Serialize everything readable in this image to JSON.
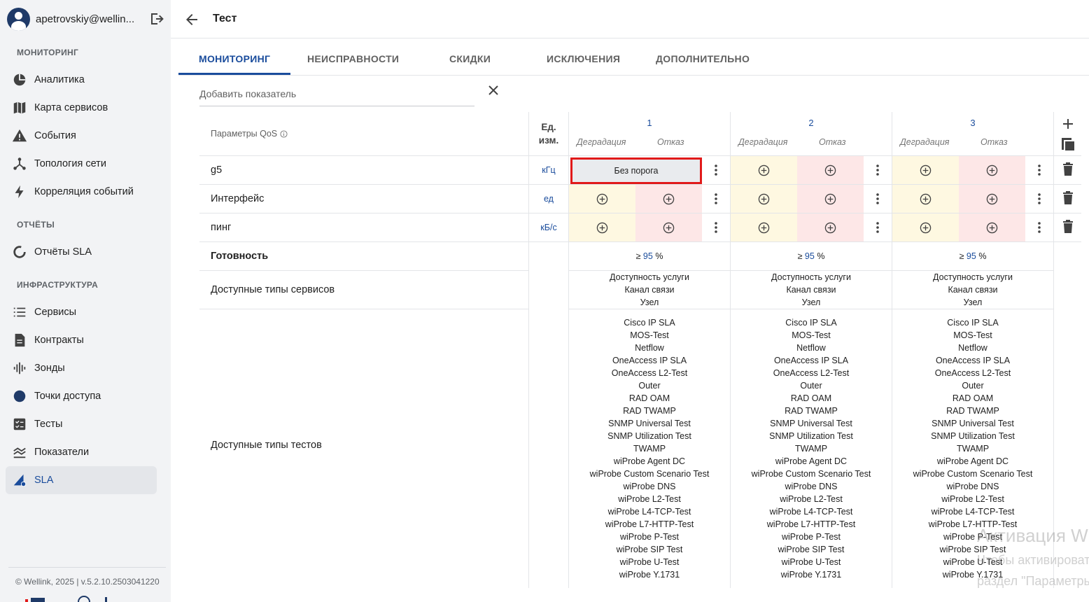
{
  "user": {
    "name": "apetrovskiy@wellin..."
  },
  "sidebar": {
    "sections": [
      {
        "title": "МОНИТОРИНГ",
        "items": [
          {
            "label": "Аналитика",
            "icon": "pie-chart-icon"
          },
          {
            "label": "Карта сервисов",
            "icon": "map-icon"
          },
          {
            "label": "События",
            "icon": "warning-icon"
          },
          {
            "label": "Топология сети",
            "icon": "topology-icon"
          },
          {
            "label": "Корреляция событий",
            "icon": "bolt-icon"
          }
        ]
      },
      {
        "title": "ОТЧЁТЫ",
        "items": [
          {
            "label": "Отчёты SLA",
            "icon": "progress-ring-icon"
          }
        ]
      },
      {
        "title": "ИНФРАСТРУКТУРА",
        "items": [
          {
            "label": "Сервисы",
            "icon": "list-icon"
          },
          {
            "label": "Контракты",
            "icon": "document-icon"
          },
          {
            "label": "Зонды",
            "icon": "waveform-icon"
          },
          {
            "label": "Точки доступа",
            "icon": "circle-icon"
          },
          {
            "label": "Тесты",
            "icon": "checklist-icon"
          },
          {
            "label": "Показатели",
            "icon": "chart-lines-icon"
          },
          {
            "label": "SLA",
            "icon": "sla-icon",
            "active": true
          }
        ]
      }
    ],
    "copyright": "© Wellink, 2025 | v.5.2.10.2503041220"
  },
  "header": {
    "title": "Тест"
  },
  "tabs": [
    "МОНИТОРИНГ",
    "НЕИСПРАВНОСТИ",
    "СКИДКИ",
    "ИСКЛЮЧЕНИЯ",
    "ДОПОЛНИТЕЛЬНО"
  ],
  "add_indicator": {
    "placeholder": "Добавить показатель"
  },
  "table": {
    "qos_header": "Параметры QoS",
    "unit_header_1": "Ед.",
    "unit_header_2": "изм.",
    "columns": [
      "1",
      "2",
      "3"
    ],
    "sub_degradation": "Деградация",
    "sub_failure": "Отказ",
    "rows": [
      {
        "name": "g5",
        "unit": "кГц"
      },
      {
        "name": "Интерфейс",
        "unit": "ед"
      },
      {
        "name": "пинг",
        "unit": "кБ/с"
      }
    ],
    "no_threshold": "Без порога",
    "readiness_label": "Готовность",
    "readiness_prefix": "≥",
    "readiness_value": "95",
    "readiness_suffix": "%",
    "service_types_label": "Доступные типы сервисов",
    "service_types": [
      "Доступность услуги",
      "Канал связи",
      "Узел"
    ],
    "test_types_label": "Доступные типы тестов",
    "test_types": [
      "Cisco IP SLA",
      "MOS-Test",
      "Netflow",
      "OneAccess IP SLA",
      "OneAccess L2-Test",
      "Outer",
      "RAD OAM",
      "RAD TWAMP",
      "SNMP Universal Test",
      "SNMP Utilization Test",
      "TWAMP",
      "wiProbe Agent DC",
      "wiProbe Custom Scenario Test",
      "wiProbe DNS",
      "wiProbe L2-Test",
      "wiProbe L4-TCP-Test",
      "wiProbe L7-HTTP-Test",
      "wiProbe P-Test",
      "wiProbe SIP Test",
      "wiProbe U-Test",
      "wiProbe Y.1731"
    ]
  },
  "watermark": {
    "line1": "Активация Windows",
    "line2": "Чтобы активировать Windows, перейдите в",
    "line3": "раздел \"Параметры\"."
  },
  "colors": {
    "accent": "#1a4c9c",
    "degradation_bg": "#fef8e1",
    "failure_bg": "#fde7e7",
    "highlight": "#e11a1a"
  }
}
